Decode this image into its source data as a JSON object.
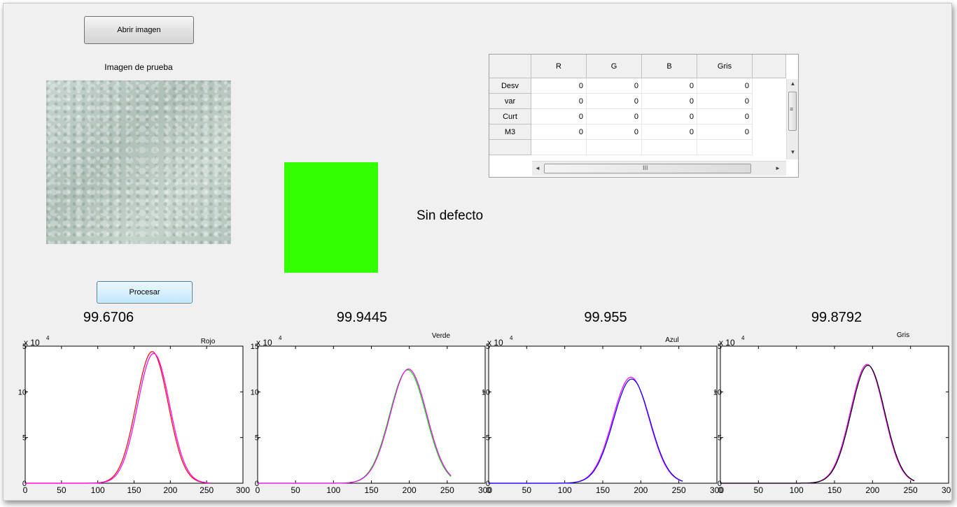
{
  "buttons": {
    "open_label": "Abrir imagen",
    "process_label": "Procesar"
  },
  "image_panel": {
    "title": "Imagen de prueba"
  },
  "result": {
    "text": "Sin defecto",
    "indicator_color": "#33ff00"
  },
  "table": {
    "columns": [
      "R",
      "G",
      "B",
      "Gris"
    ],
    "rows": [
      {
        "label": "Desv",
        "values": [
          "0",
          "0",
          "0",
          "0"
        ]
      },
      {
        "label": "var",
        "values": [
          "0",
          "0",
          "0",
          "0"
        ]
      },
      {
        "label": "Curt",
        "values": [
          "0",
          "0",
          "0",
          "0"
        ]
      },
      {
        "label": "M3",
        "values": [
          "0",
          "0",
          "0",
          "0"
        ]
      }
    ],
    "hscroll_grip": "III",
    "vscroll_grip": "≡"
  },
  "chart_data": [
    {
      "type": "line",
      "score": "99.6706",
      "title": "Rojo",
      "exponent_label": "x 10",
      "exponent_power": "4",
      "xlim": [
        0,
        300
      ],
      "ylim": [
        0,
        15
      ],
      "xticks": [
        0,
        50,
        100,
        150,
        200,
        250,
        300
      ],
      "xtick_labels": [
        "0",
        "50",
        "100",
        "150",
        "200",
        "250",
        "300"
      ],
      "yticks": [
        0,
        5,
        10,
        15
      ],
      "ytick_labels": [
        "0",
        "5",
        "10",
        "5"
      ],
      "series": [
        {
          "color": "#ff0000",
          "peak_x": 175,
          "peak_y": 14.4,
          "sigma": 22
        },
        {
          "color": "#ff00ff",
          "peak_x": 177,
          "peak_y": 14.2,
          "sigma": 22
        }
      ]
    },
    {
      "type": "line",
      "score": "99.9445",
      "title": "Verde",
      "exponent_label": "x 10",
      "exponent_power": "4",
      "xlim": [
        0,
        300
      ],
      "ylim": [
        0,
        15
      ],
      "xticks": [
        0,
        50,
        100,
        150,
        200,
        250,
        300
      ],
      "xtick_labels": [
        "0",
        "50",
        "100",
        "150",
        "200",
        "250",
        "300"
      ],
      "yticks": [
        0,
        5,
        10,
        15
      ],
      "ytick_labels": [
        "0",
        "5",
        "10",
        "15"
      ],
      "series": [
        {
          "color": "#00dd00",
          "peak_x": 198,
          "peak_y": 12.4,
          "sigma": 24
        },
        {
          "color": "#ff00ff",
          "peak_x": 199,
          "peak_y": 12.5,
          "sigma": 24
        }
      ]
    },
    {
      "type": "line",
      "score": "99.955",
      "title": "Azul",
      "exponent_label": "x 10",
      "exponent_power": "4",
      "xlim": [
        0,
        300
      ],
      "ylim": [
        0,
        15
      ],
      "xticks": [
        0,
        50,
        100,
        150,
        200,
        250,
        300
      ],
      "xtick_labels": [
        "0",
        "50",
        "100",
        "150",
        "200",
        "250",
        "300"
      ],
      "yticks": [
        0,
        5,
        10,
        15
      ],
      "ytick_labels": [
        "0",
        "5",
        "10",
        "5"
      ],
      "series": [
        {
          "color": "#ff00ff",
          "peak_x": 187,
          "peak_y": 11.6,
          "sigma": 24
        },
        {
          "color": "#0000ff",
          "peak_x": 188,
          "peak_y": 11.4,
          "sigma": 24
        }
      ]
    },
    {
      "type": "line",
      "score": "99.8792",
      "title": "Gris",
      "exponent_label": "x 10",
      "exponent_power": "4",
      "xlim": [
        0,
        300
      ],
      "ylim": [
        0,
        15
      ],
      "xticks": [
        0,
        50,
        100,
        150,
        200,
        250,
        300
      ],
      "xtick_labels": [
        "0",
        "50",
        "100",
        "150",
        "200",
        "250",
        "300"
      ],
      "yticks": [
        0,
        5,
        10,
        15
      ],
      "ytick_labels": [
        "0",
        "5",
        "10",
        "5"
      ],
      "series": [
        {
          "color": "#ff00ff",
          "peak_x": 193,
          "peak_y": 13.0,
          "sigma": 22
        },
        {
          "color": "#000000",
          "peak_x": 194,
          "peak_y": 12.9,
          "sigma": 22
        }
      ]
    }
  ]
}
